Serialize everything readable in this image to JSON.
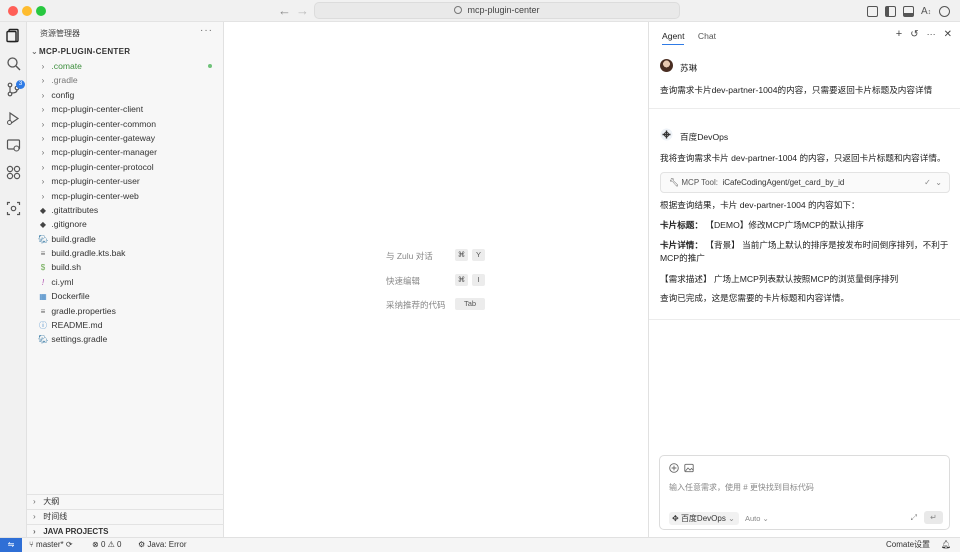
{
  "window": {
    "title": "mcp-plugin-center"
  },
  "sidebar": {
    "header": "资源管理器",
    "more": "···",
    "project_title": "MCP-PLUGIN-CENTER",
    "tree": [
      {
        "label": ".comate",
        "kind": "folder",
        "icon": "chevron-right-icon",
        "dim": false,
        "modified": true,
        "color": "#3e8f3e"
      },
      {
        "label": ".gradle",
        "kind": "folder",
        "icon": "chevron-right-icon",
        "dim": true,
        "modified": false
      },
      {
        "label": "config",
        "kind": "folder",
        "icon": "chevron-right-icon",
        "dim": false,
        "modified": false
      },
      {
        "label": "mcp-plugin-center-client",
        "kind": "folder",
        "icon": "chevron-right-icon",
        "dim": false,
        "modified": false
      },
      {
        "label": "mcp-plugin-center-common",
        "kind": "folder",
        "icon": "chevron-right-icon",
        "dim": false,
        "modified": false
      },
      {
        "label": "mcp-plugin-center-gateway",
        "kind": "folder",
        "icon": "chevron-right-icon",
        "dim": false,
        "modified": false
      },
      {
        "label": "mcp-plugin-center-manager",
        "kind": "folder",
        "icon": "chevron-right-icon",
        "dim": false,
        "modified": false
      },
      {
        "label": "mcp-plugin-center-protocol",
        "kind": "folder",
        "icon": "chevron-right-icon",
        "dim": false,
        "modified": false
      },
      {
        "label": "mcp-plugin-center-user",
        "kind": "folder",
        "icon": "chevron-right-icon",
        "dim": false,
        "modified": false
      },
      {
        "label": "mcp-plugin-center-web",
        "kind": "folder",
        "icon": "chevron-right-icon",
        "dim": false,
        "modified": false
      },
      {
        "label": ".gitattributes",
        "kind": "file",
        "icon": "git-file-icon",
        "dim": false,
        "modified": false
      },
      {
        "label": ".gitignore",
        "kind": "file",
        "icon": "git-file-icon",
        "dim": false,
        "modified": false
      },
      {
        "label": "build.gradle",
        "kind": "file",
        "icon": "gradle-file-icon",
        "dim": false,
        "modified": false
      },
      {
        "label": "build.gradle.kts.bak",
        "kind": "file",
        "icon": "text-file-icon",
        "dim": false,
        "modified": false
      },
      {
        "label": "build.sh",
        "kind": "file",
        "icon": "shell-file-icon",
        "dim": false,
        "modified": false
      },
      {
        "label": "ci.yml",
        "kind": "file",
        "icon": "yaml-file-icon",
        "dim": false,
        "modified": false
      },
      {
        "label": "Dockerfile",
        "kind": "file",
        "icon": "docker-file-icon",
        "dim": false,
        "modified": false
      },
      {
        "label": "gradle.properties",
        "kind": "file",
        "icon": "text-file-icon",
        "dim": false,
        "modified": false
      },
      {
        "label": "README.md",
        "kind": "file",
        "icon": "info-file-icon",
        "dim": false,
        "modified": false
      },
      {
        "label": "settings.gradle",
        "kind": "file",
        "icon": "gradle-file-icon",
        "dim": false,
        "modified": false
      }
    ],
    "bottom_sections": [
      "大纲",
      "时间线",
      "JAVA PROJECTS"
    ]
  },
  "editor": {
    "hints": [
      {
        "label": "与 Zulu 对话",
        "keys": [
          "⌘",
          "Y"
        ]
      },
      {
        "label": "快速编辑",
        "keys": [
          "⌘",
          "I"
        ]
      },
      {
        "label": "采纳推荐的代码",
        "keys": [
          "Tab"
        ]
      }
    ]
  },
  "chat": {
    "tabs": [
      "Agent",
      "Chat"
    ],
    "active_tab": "Agent",
    "user_name": "苏琳",
    "user_message": "查询需求卡片dev-partner-1004的内容，只需要返回卡片标题及内容详情",
    "bot_name": "百度DevOps",
    "bot_intro": "我将查询需求卡片 dev-partner-1004 的内容，只返回卡片标题和内容详情。",
    "tool_label": "MCP Tool:",
    "tool_name": "iCafeCodingAgent/get_card_by_id",
    "result_intro": "根据查询结果，卡片 dev-partner-1004 的内容如下：",
    "title_label": "卡片标题：",
    "title_value": "【DEMO】修改MCP广场MCP的默认排序",
    "detail_label": "卡片详情：",
    "detail_value": "【背景】 当前广场上默认的排序是按发布时间倒序排列，不利于MCP的推广",
    "requirement": "【需求描述】 广场上MCP列表默认按照MCP的浏览量倒序排列",
    "closing": "查询已完成，这是您需要的卡片标题和内容详情。",
    "input_placeholder": "输入任意需求，使用 # 更快找到目标代码",
    "model": "百度DevOps",
    "mode": "Auto"
  },
  "statusbar": {
    "branch": "master*",
    "errors": "0",
    "warnings": "0",
    "java_status": "Java: Error",
    "right_label": "Comate设置"
  },
  "badges": {
    "source_control": "3"
  },
  "colors": {
    "accent": "#2f7be6",
    "remote": "#2f6fd6",
    "modified_dot": "#6fc27a"
  }
}
